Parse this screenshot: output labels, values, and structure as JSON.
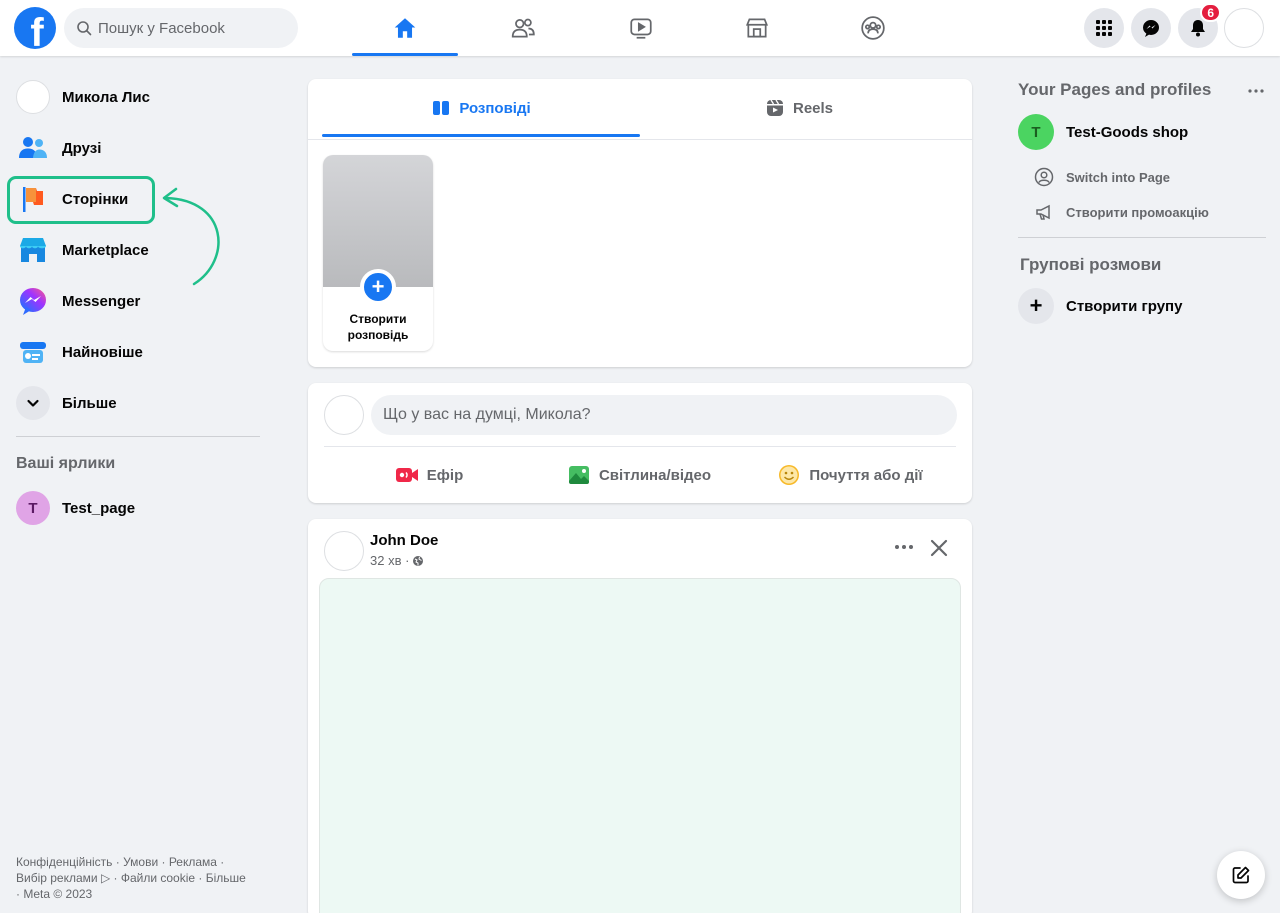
{
  "topbar": {
    "logo": "f",
    "search_placeholder": "Пошук у Facebook",
    "nav_tabs": [
      {
        "icon": "home-icon",
        "active": true
      },
      {
        "icon": "friends-icon",
        "active": false
      },
      {
        "icon": "watch-icon",
        "active": false
      },
      {
        "icon": "marketplace-icon",
        "active": false
      },
      {
        "icon": "groups-icon",
        "active": false
      }
    ],
    "notification_count": "6"
  },
  "sidebar": {
    "items": [
      {
        "label": "Микола Лис",
        "icon": "profile-avatar"
      },
      {
        "label": "Друзі",
        "icon": "friends-icon"
      },
      {
        "label": "Сторінки",
        "icon": "pages-flag-icon"
      },
      {
        "label": "Marketplace",
        "icon": "marketplace-icon"
      },
      {
        "label": "Messenger",
        "icon": "messenger-icon"
      },
      {
        "label": "Найновіше",
        "icon": "feeds-icon"
      },
      {
        "label": "Більше",
        "icon": "chevron-down-icon"
      }
    ],
    "shortcuts_title": "Ваші ярлики",
    "shortcut": {
      "initial": "T",
      "label": "Test_page"
    },
    "footer_line1": "Конфіденційність · Умови · Реклама ·",
    "footer_line2": "Вибір реклами ▷ · Файли cookie · Більше",
    "footer_line3": "· Meta © 2023"
  },
  "stories": {
    "tab_stories": "Розповіді",
    "tab_reels": "Reels",
    "create_label": "Створити розповідь"
  },
  "composer": {
    "placeholder": "Що у вас на думці, Микола?",
    "live": "Ефір",
    "photo": "Світлина/відео",
    "feeling": "Почуття або дії"
  },
  "post": {
    "author": "John Doe",
    "time": "32 хв ·"
  },
  "right": {
    "pages_title": "Your Pages and profiles",
    "page": {
      "initial": "T",
      "name": "Test-Goods shop"
    },
    "switch_label": "Switch into Page",
    "promo_label": "Створити промоакцію",
    "groups_title": "Групові розмови",
    "create_group": "Створити групу"
  },
  "colors": {
    "brand": "#1877f2",
    "highlight": "#1fbf8a",
    "badge": "#e41e3f"
  }
}
